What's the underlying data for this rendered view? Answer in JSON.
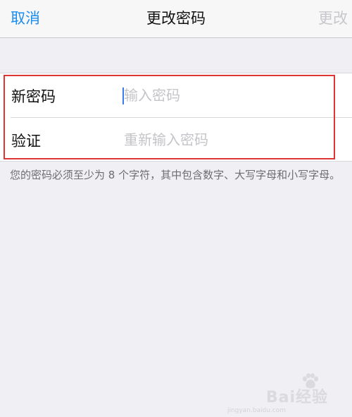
{
  "navbar": {
    "cancel_label": "取消",
    "title": "更改密码",
    "done_label": "更改"
  },
  "form": {
    "new_password": {
      "label": "新密码",
      "placeholder": "输入密码",
      "value": ""
    },
    "verify": {
      "label": "验证",
      "placeholder": "重新输入密码",
      "value": ""
    }
  },
  "hint": "您的密码必须至少为 8 个字符，其中包含数字、大写字母和小写字母。",
  "watermark": {
    "text": "Bai经验",
    "sub": "jingyan.baidu.com"
  },
  "colors": {
    "accent": "#1a8cf0",
    "disabled": "#c7c7cc",
    "highlight": "#e03535",
    "background": "#efeff4"
  }
}
